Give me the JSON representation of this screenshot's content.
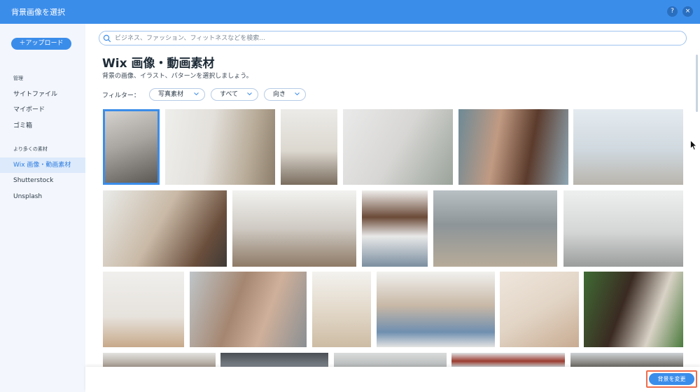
{
  "window": {
    "title": "背景画像を選択",
    "help_label": "?",
    "close_label": "×"
  },
  "sidebar": {
    "upload_label": "＋アップロード",
    "manage_heading": "管理",
    "manage_items": [
      {
        "label": "サイトファイル"
      },
      {
        "label": "マイボード"
      },
      {
        "label": "ゴミ箱"
      }
    ],
    "more_heading": "より多くの素材",
    "more_items": [
      {
        "label": "Wix 画像・動画素材",
        "active": true
      },
      {
        "label": "Shutterstock",
        "active": false
      },
      {
        "label": "Unsplash",
        "active": false
      }
    ]
  },
  "search": {
    "placeholder": "ビジネス、ファッション、フィットネスなどを検索..."
  },
  "main": {
    "heading": "Wix 画像・動画素材",
    "subheading": "背景の画像、イラスト、パターンを選択しましょう。"
  },
  "filters": {
    "label": "フィルター：",
    "items": [
      {
        "label": "写真素材"
      },
      {
        "label": "すべて"
      },
      {
        "label": "向き"
      }
    ]
  },
  "footer": {
    "change_button_label": "背景を変更"
  },
  "colors": {
    "accent": "#3b8dea",
    "highlight_border": "#ef6c4a",
    "sidebar_bg": "#f3f6fc",
    "active_item_bg": "#dceafc"
  },
  "gallery": {
    "thumbnails": [
      {
        "name": "thumb-coffee-pourover",
        "selected": true
      },
      {
        "name": "thumb-woman-mask-laptop",
        "selected": false
      },
      {
        "name": "thumb-living-room",
        "selected": false
      },
      {
        "name": "thumb-yoga-couple",
        "selected": false
      },
      {
        "name": "thumb-two-women-smiling",
        "selected": false
      },
      {
        "name": "thumb-terrace-view",
        "selected": false
      },
      {
        "name": "thumb-couple-kitchen",
        "selected": false
      },
      {
        "name": "thumb-gym-jump",
        "selected": false
      },
      {
        "name": "thumb-woman-sitting",
        "selected": false
      },
      {
        "name": "thumb-couple-beach-walk",
        "selected": false
      },
      {
        "name": "thumb-office-wheelchair",
        "selected": false
      },
      {
        "name": "thumb-pampas-vase",
        "selected": false
      },
      {
        "name": "thumb-couple-cuddle",
        "selected": false
      },
      {
        "name": "thumb-dried-grass",
        "selected": false
      },
      {
        "name": "thumb-father-child-study",
        "selected": false
      },
      {
        "name": "thumb-flour-heart",
        "selected": false
      },
      {
        "name": "thumb-couple-laughing",
        "selected": false
      },
      {
        "name": "thumb-row4-a",
        "selected": false
      },
      {
        "name": "thumb-row4-b",
        "selected": false
      },
      {
        "name": "thumb-row4-c",
        "selected": false
      },
      {
        "name": "thumb-row4-d",
        "selected": false
      },
      {
        "name": "thumb-row4-e",
        "selected": false
      }
    ]
  }
}
